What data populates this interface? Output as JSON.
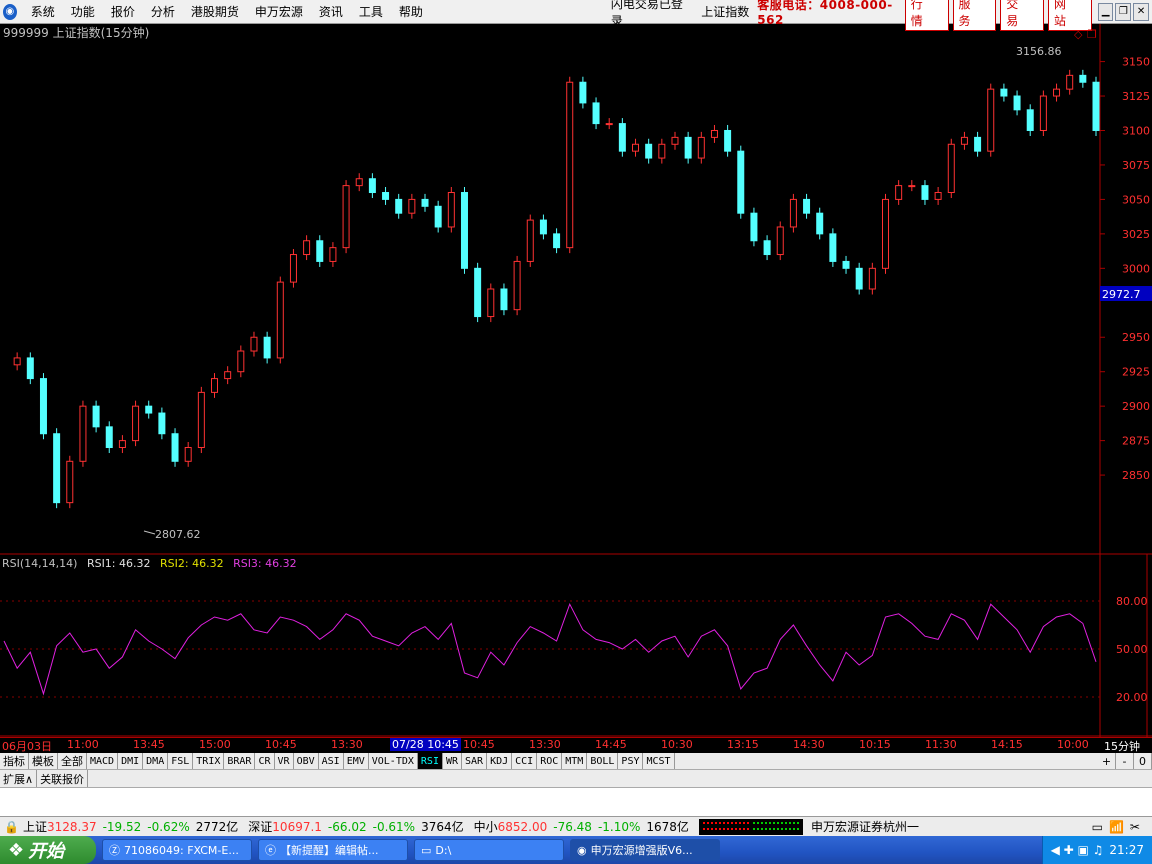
{
  "menu": {
    "items": [
      "系统",
      "功能",
      "报价",
      "分析",
      "港股期货",
      "申万宏源",
      "资讯",
      "工具",
      "帮助"
    ],
    "status": "闪电交易已登录",
    "index_name": "上证指数",
    "hotline": "客服电话：4008-000-562",
    "service_buttons": [
      "行 情",
      "服 务",
      "交 易",
      "网 站"
    ]
  },
  "main": {
    "title": "999999 上证指数(15分钟)",
    "high_label": "3156.86",
    "low_label": "2807.62",
    "price_ticks": [
      "3150",
      "3125",
      "3100",
      "3075",
      "3050",
      "3025",
      "3000",
      "2950",
      "2925",
      "2900",
      "2875",
      "2850"
    ],
    "current_price": "2972.7"
  },
  "rsi": {
    "title": "RSI(14,14,14)",
    "rsi1": "RSI1: 46.32",
    "rsi2": "RSI2: 46.32",
    "rsi3": "RSI3: 46.32",
    "ticks": [
      "80.00",
      "50.00",
      "20.00"
    ]
  },
  "time_axis": {
    "labels": [
      "06月03日",
      "11:00",
      "13:45",
      "15:00",
      "10:45",
      "13:30",
      "07/28 10:45",
      "10:45",
      "13:30",
      "14:45",
      "10:30",
      "13:15",
      "14:30",
      "10:15",
      "11:30",
      "14:15",
      "10:00"
    ],
    "period": "15分钟"
  },
  "indicator_tabs": [
    "指标",
    "模板",
    "全部",
    "MACD",
    "DMI",
    "DMA",
    "FSL",
    "TRIX",
    "BRAR",
    "CR",
    "VR",
    "OBV",
    "ASI",
    "EMV",
    "VOL-TDX",
    "RSI",
    "WR",
    "SAR",
    "KDJ",
    "CCI",
    "ROC",
    "MTM",
    "BOLL",
    "PSY",
    "MCST"
  ],
  "tab_controls": [
    "+",
    "-",
    "0"
  ],
  "sub_tabs": [
    "扩展∧",
    "关联报价"
  ],
  "status_bar": {
    "sh": {
      "name": "上证",
      "price": "3128.37",
      "chg": "-19.52",
      "pct": "-0.62%",
      "amt": "2772亿"
    },
    "sz": {
      "name": "深证",
      "price": "10697.1",
      "chg": "-66.02",
      "pct": "-0.61%",
      "amt": "3764亿"
    },
    "zx": {
      "name": "中小",
      "price": "6852.00",
      "chg": "-76.48",
      "pct": "-1.10%",
      "amt": "1678亿"
    },
    "broker": "申万宏源证券杭州一"
  },
  "taskbar": {
    "start": "开始",
    "tasks": [
      "71086049: FXCM-E...",
      "【新提醒】编辑帖...",
      "D:\\",
      "申万宏源增强版V6..."
    ],
    "clock": "21:27"
  },
  "chart_data": {
    "type": "candlestick",
    "title": "999999 上证指数(15分钟)",
    "close": [
      2930,
      2935,
      2920,
      2880,
      2830,
      2860,
      2900,
      2885,
      2870,
      2875,
      2900,
      2895,
      2880,
      2860,
      2870,
      2910,
      2920,
      2925,
      2940,
      2950,
      2935,
      2990,
      3010,
      3020,
      3005,
      3015,
      3060,
      3065,
      3055,
      3050,
      3040,
      3050,
      3045,
      3030,
      3055,
      3000,
      2965,
      2985,
      2970,
      3005,
      3035,
      3025,
      3015,
      3135,
      3120,
      3105,
      3105,
      3085,
      3090,
      3080,
      3090,
      3095,
      3080,
      3095,
      3100,
      3085,
      3040,
      3020,
      3010,
      3030,
      3050,
      3040,
      3025,
      3005,
      3000,
      2985,
      3000,
      3050,
      3060,
      3060,
      3050,
      3055,
      3090,
      3095,
      3085,
      3130,
      3125,
      3115,
      3100,
      3125,
      3130,
      3140,
      3135,
      3100
    ],
    "rsi": [
      55,
      38,
      48,
      22,
      52,
      60,
      48,
      50,
      38,
      45,
      62,
      55,
      50,
      44,
      57,
      65,
      70,
      68,
      72,
      62,
      60,
      70,
      68,
      64,
      56,
      62,
      72,
      68,
      58,
      55,
      52,
      60,
      64,
      56,
      66,
      35,
      32,
      48,
      40,
      54,
      64,
      60,
      55,
      78,
      62,
      56,
      54,
      50,
      56,
      48,
      55,
      58,
      45,
      58,
      62,
      52,
      25,
      35,
      38,
      56,
      65,
      52,
      40,
      30,
      48,
      40,
      46,
      70,
      72,
      66,
      58,
      56,
      72,
      68,
      56,
      78,
      70,
      62,
      48,
      64,
      70,
      72,
      66,
      42
    ],
    "ylim": [
      2800,
      3170
    ],
    "rsi_ticks": [
      20,
      50,
      80
    ]
  }
}
